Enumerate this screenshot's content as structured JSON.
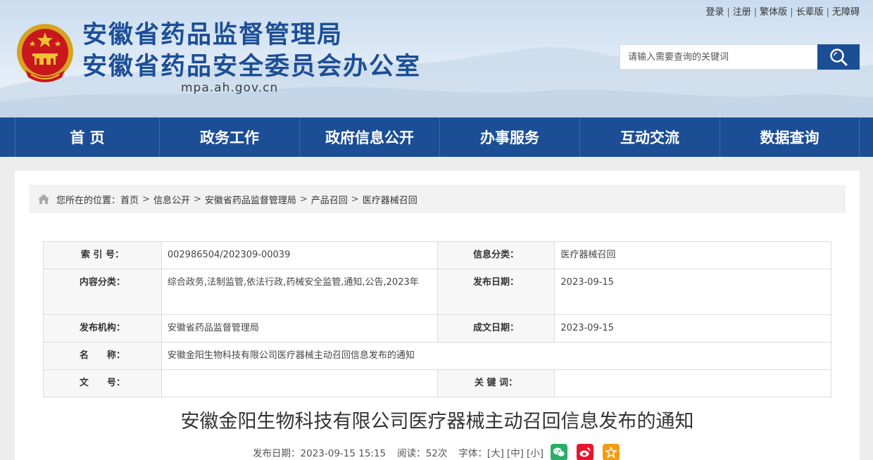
{
  "header": {
    "title": "安徽省药品监督管理局",
    "subtitle": "安徽省药品安全委员会办公室",
    "domain": "mpa.ah.gov.cn",
    "toplinks": [
      "登录",
      "注册",
      "繁体版",
      "长辈版",
      "无障碍"
    ],
    "search_placeholder": "请输入需要查询的关键词"
  },
  "nav": [
    "首 页",
    "政务工作",
    "政府信息公开",
    "办事服务",
    "互动交流",
    "数据查询"
  ],
  "breadcrumb": {
    "prefix": "您所在的位置：",
    "items": [
      "首页",
      "信息公开",
      "安徽省药品监督管理局",
      "产品召回",
      "医疗器械召回"
    ],
    "separator": ">"
  },
  "meta": {
    "index_label": "索 引 号：",
    "index_value": "002986504/202309-00039",
    "category_label": "信息分类：",
    "category_value": "医疗器械召回",
    "content_label": "内容分类：",
    "content_value": "综合政务,法制监管,依法行政,药械安全监管,通知,公告,2023年",
    "pubdate_label": "发布日期：",
    "pubdate_value": "2023-09-15",
    "org_label": "发布机构：",
    "org_value": "安徽省药品监督管理局",
    "created_label": "成文日期：",
    "created_value": "2023-09-15",
    "name_label": "名　　称：",
    "name_value": "安徽金阳生物科技有限公司医疗器械主动召回信息发布的通知",
    "docno_label": "文　　号：",
    "docno_value": "",
    "keywords_label": "关 键 词：",
    "keywords_value": ""
  },
  "article": {
    "title": "安徽金阳生物科技有限公司医疗器械主动召回信息发布的通知",
    "date_text": "发布日期：2023-09-15 15:15",
    "reads_text": "阅读：52次",
    "font_label": "字体：",
    "font_sizes": [
      "[大]",
      "[中]",
      "[小]"
    ],
    "share_icons": [
      "wechat-icon",
      "weibo-icon",
      "favorite-icon"
    ]
  },
  "colors": {
    "brand_blue": "#1c4e96",
    "wechat": "#2aae67",
    "weibo": "#e6162d",
    "favorite": "#f39b12"
  }
}
